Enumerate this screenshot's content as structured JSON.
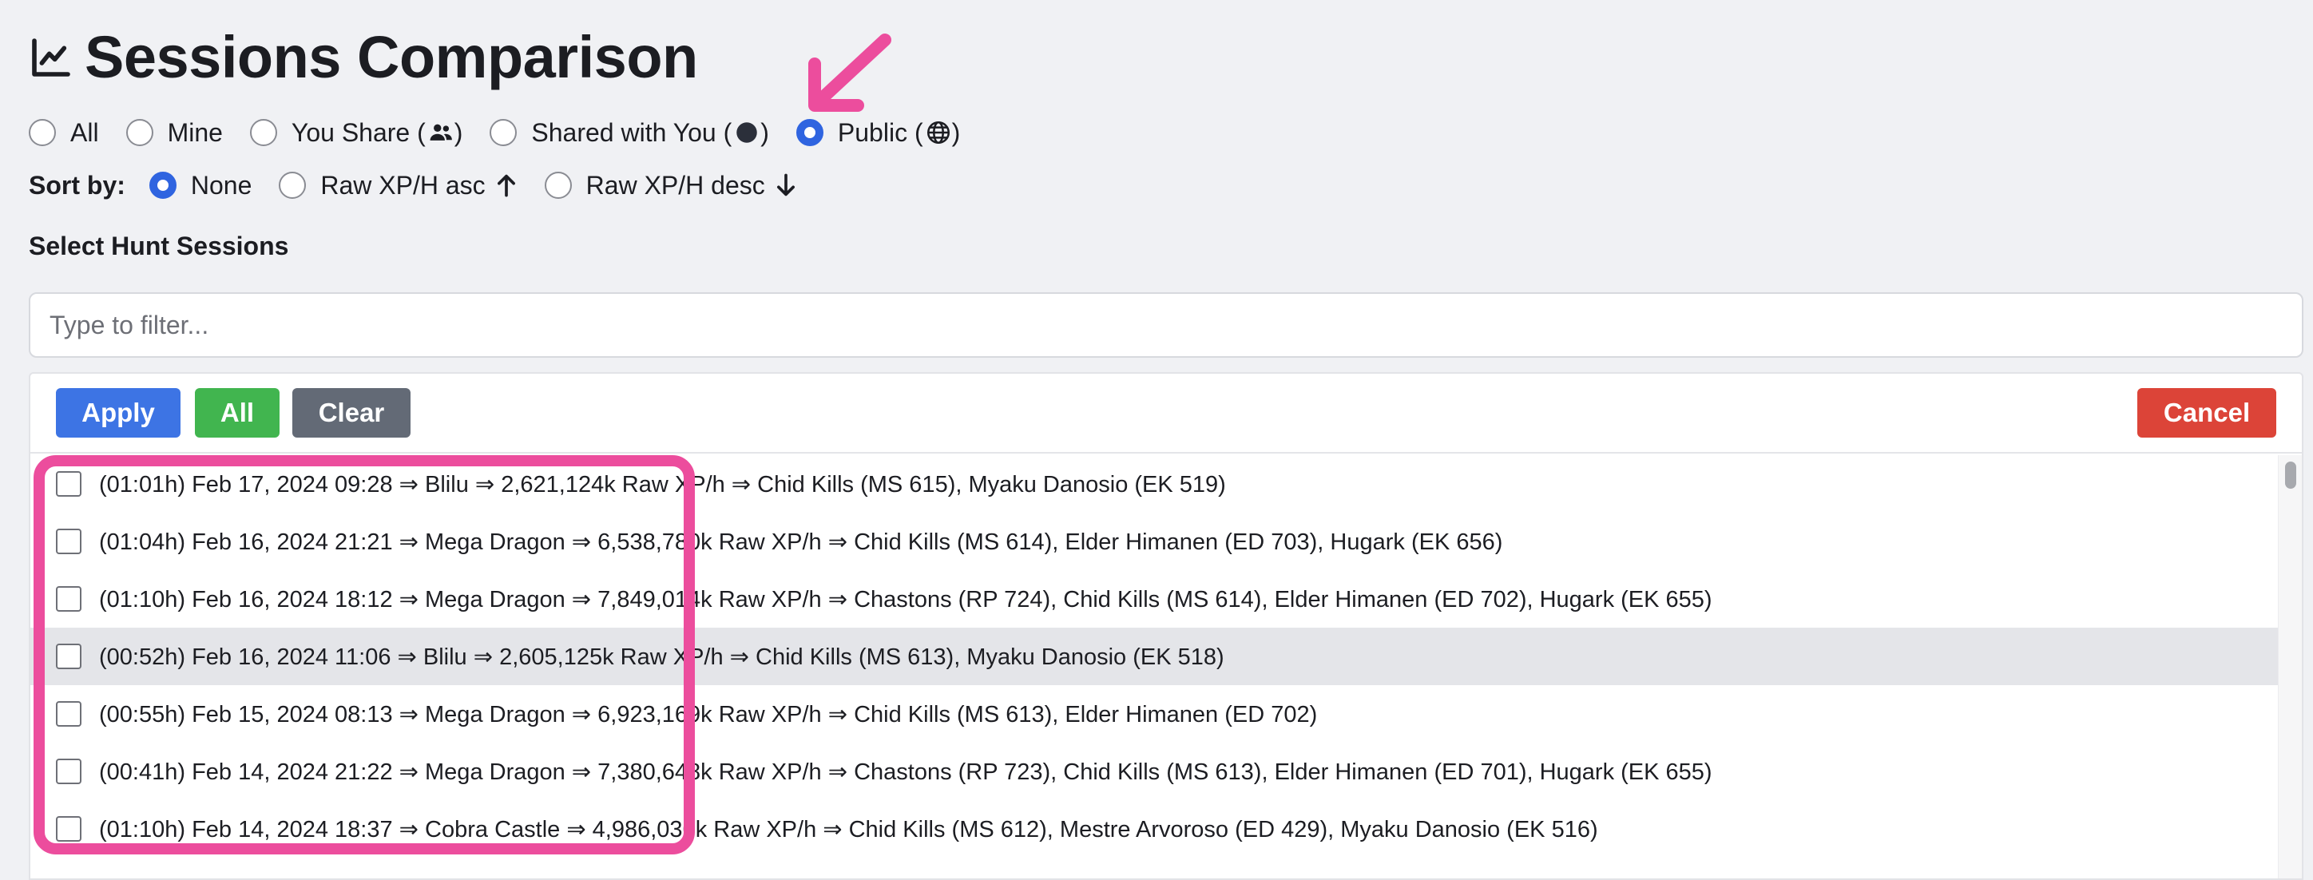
{
  "page": {
    "title": "Sessions Comparison",
    "title_icon": "line-chart-icon"
  },
  "visibility_filter": {
    "selected": "Public",
    "options": [
      {
        "label": "All",
        "icon": null,
        "checked": false
      },
      {
        "label": "Mine",
        "icon": null,
        "checked": false
      },
      {
        "label": "You Share",
        "icon": "users-icon",
        "checked": false
      },
      {
        "label": "Shared with You",
        "icon": "dot-icon",
        "checked": false
      },
      {
        "label": "Public",
        "icon": "globe-icon",
        "checked": true
      }
    ]
  },
  "sort": {
    "label": "Sort by:",
    "options": [
      {
        "label": "None",
        "checked": true
      },
      {
        "label": "Raw XP/H asc",
        "icon": "arrow-up-icon",
        "checked": false
      },
      {
        "label": "Raw XP/H desc",
        "icon": "arrow-down-icon",
        "checked": false
      }
    ]
  },
  "section_label": "Select Hunt Sessions",
  "filter": {
    "placeholder": "Type to filter...",
    "value": ""
  },
  "buttons": {
    "apply": "Apply",
    "all": "All",
    "clear": "Clear",
    "cancel": "Cancel"
  },
  "sessions": [
    "(01:01h) Feb 17, 2024 09:28 ⇒ Blilu ⇒ 2,621,124k Raw XP/h ⇒ Chid Kills (MS 615), Myaku Danosio (EK 519)",
    "(01:04h) Feb 16, 2024 21:21 ⇒ Mega Dragon ⇒ 6,538,780k Raw XP/h ⇒ Chid Kills (MS 614), Elder Himanen (ED 703), Hugark (EK 656)",
    "(01:10h) Feb 16, 2024 18:12 ⇒ Mega Dragon ⇒ 7,849,014k Raw XP/h ⇒ Chastons (RP 724), Chid Kills (MS 614), Elder Himanen (ED 702), Hugark (EK 655)",
    "(00:52h) Feb 16, 2024 11:06 ⇒ Blilu ⇒ 2,605,125k Raw XP/h ⇒ Chid Kills (MS 613), Myaku Danosio (EK 518)",
    "(00:55h) Feb 15, 2024 08:13 ⇒ Mega Dragon ⇒ 6,923,169k Raw XP/h ⇒ Chid Kills (MS 613), Elder Himanen (ED 702)",
    "(00:41h) Feb 14, 2024 21:22 ⇒ Mega Dragon ⇒ 7,380,648k Raw XP/h ⇒ Chastons (RP 723), Chid Kills (MS 613), Elder Himanen (ED 701), Hugark (EK 655)",
    "(01:10h) Feb 14, 2024 18:37 ⇒ Cobra Castle ⇒ 4,986,030k Raw XP/h ⇒ Chid Kills (MS 612), Mestre Arvoroso (ED 429), Myaku Danosio (EK 516)"
  ],
  "colors": {
    "accent": "#2f64e0",
    "apply": "#3d74e4",
    "all": "#41b54f",
    "clear": "#636a76",
    "cancel": "#dc4438",
    "annotation": "#ec4d9d"
  }
}
